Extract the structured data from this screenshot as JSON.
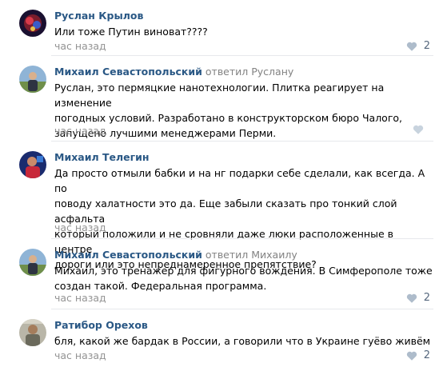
{
  "comments": [
    {
      "author": "Руслан Крылов",
      "reply_to": "",
      "lines": [
        "Или тоже Путин виноват????"
      ],
      "time": "час назад",
      "likes": "2"
    },
    {
      "author": "Михаил Севастопольский",
      "reply_to": "ответил Руслану",
      "lines": [
        "Руслан, это пермяцкие нанотехнологии. Плитка реагирует на изменение",
        "погодных условий. Разработано в конструкторском бюро Чалого,",
        "запущено лучшими менеджерами Перми."
      ],
      "time": "час назад",
      "likes": ""
    },
    {
      "author": "Михаил Телегин",
      "reply_to": "",
      "lines": [
        "Да просто отмыли бабки и на нг подарки себе сделали, как всегда. А по",
        "поводу халатности это да. Еще забыли сказать про тонкий слой асфальта",
        "который положили и не сровняли даже люки расположенные в центре",
        "дороги или это непреднамеренное препятствие?"
      ],
      "time": "час назад",
      "likes": ""
    },
    {
      "author": "Михаил Севастопольский",
      "reply_to": "ответил Михаилу",
      "lines": [
        "Михаил, это тренажер для фигурного вождения. В Симферополе тоже",
        "создан такой. Федеральная программа."
      ],
      "time": "час назад",
      "likes": "2"
    },
    {
      "author": "Ратибор Орехов",
      "reply_to": "",
      "lines": [
        "бля, какой же бардак в России, а говорили что в Украине гуёво живём"
      ],
      "time": "час назад",
      "likes": "2"
    }
  ]
}
